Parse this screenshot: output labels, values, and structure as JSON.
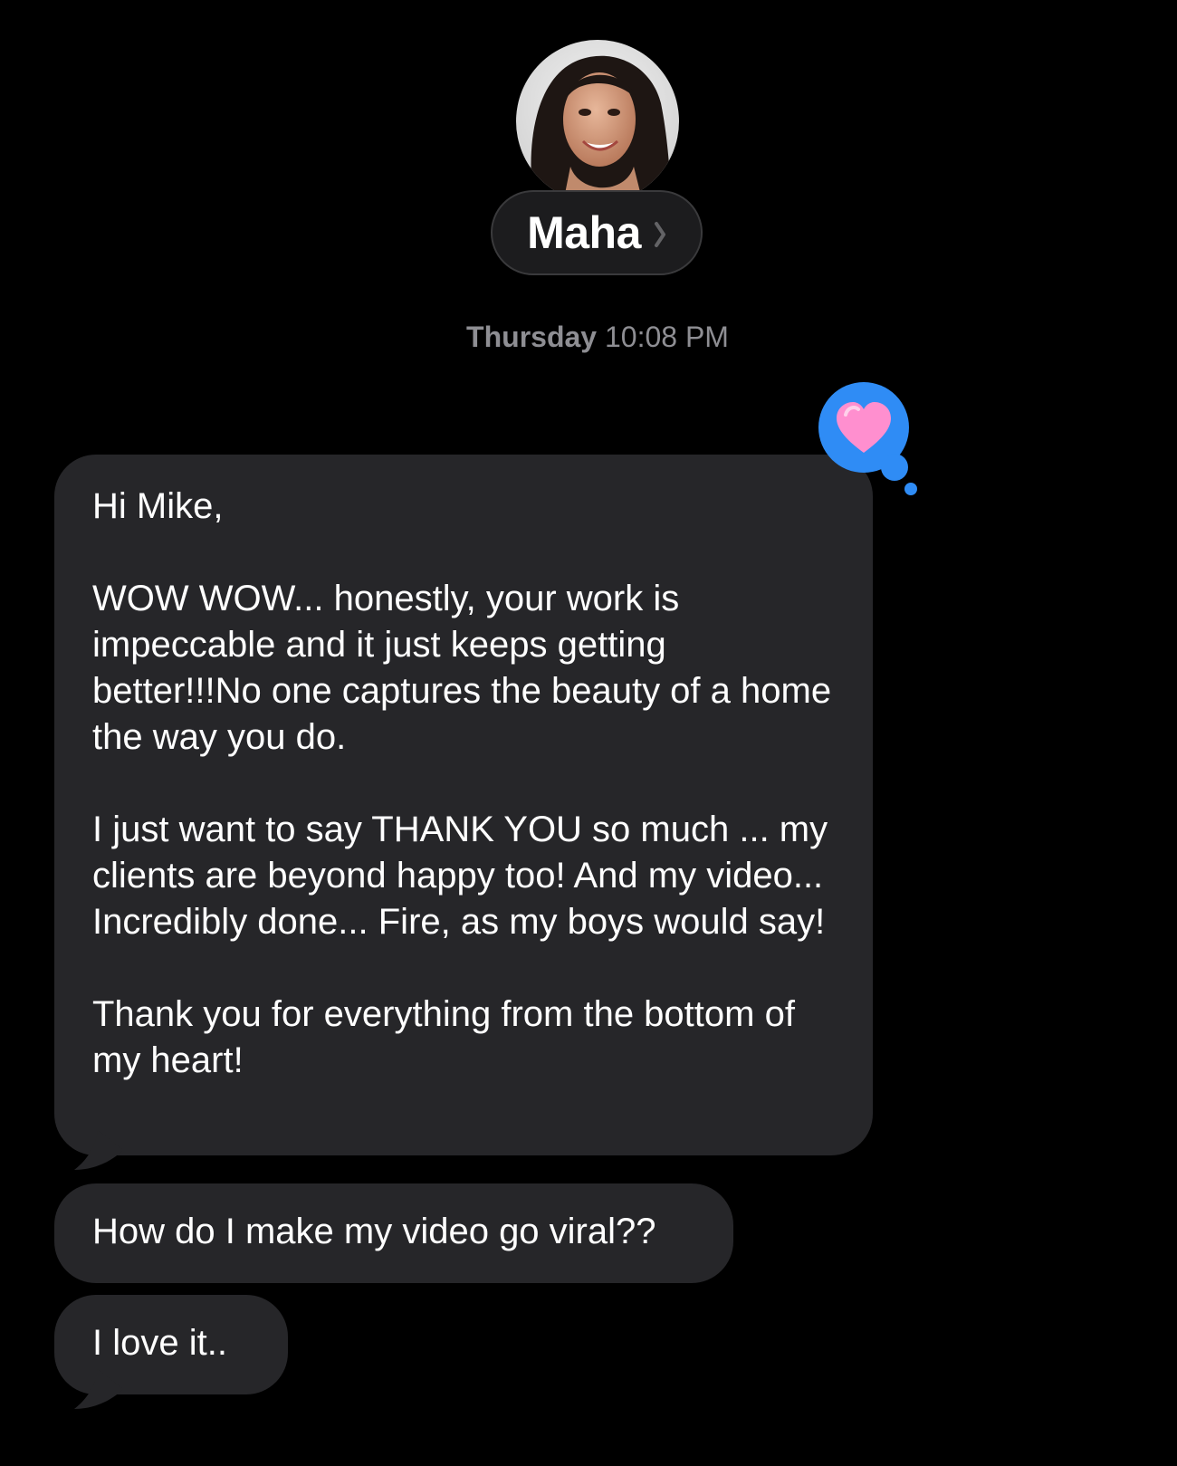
{
  "contact": {
    "name": "Maha",
    "avatar_icon": "contact-photo"
  },
  "thread": {
    "timestamp_day": "Thursday",
    "timestamp_time": "10:08 PM"
  },
  "messages": [
    {
      "text": "Hi Mike,\n\nWOW WOW... honestly, your work is impeccable and it just keeps getting better!!!No one captures the beauty of a home the way you do.\n\nI just want to say THANK YOU so much ... my clients are beyond happy too! And my video... Incredibly done... Fire, as my boys would say!\n\nThank you for everything from the bottom of my heart!",
      "reaction": "heart"
    },
    {
      "text": "How do I make my video go viral??"
    },
    {
      "text": "I love it.."
    }
  ],
  "colors": {
    "background": "#000000",
    "bubble": "#262629",
    "timestamp": "#8e8e93",
    "tapback_blue": "#2f8cf5",
    "heart_pink": "#ff8fcf"
  }
}
